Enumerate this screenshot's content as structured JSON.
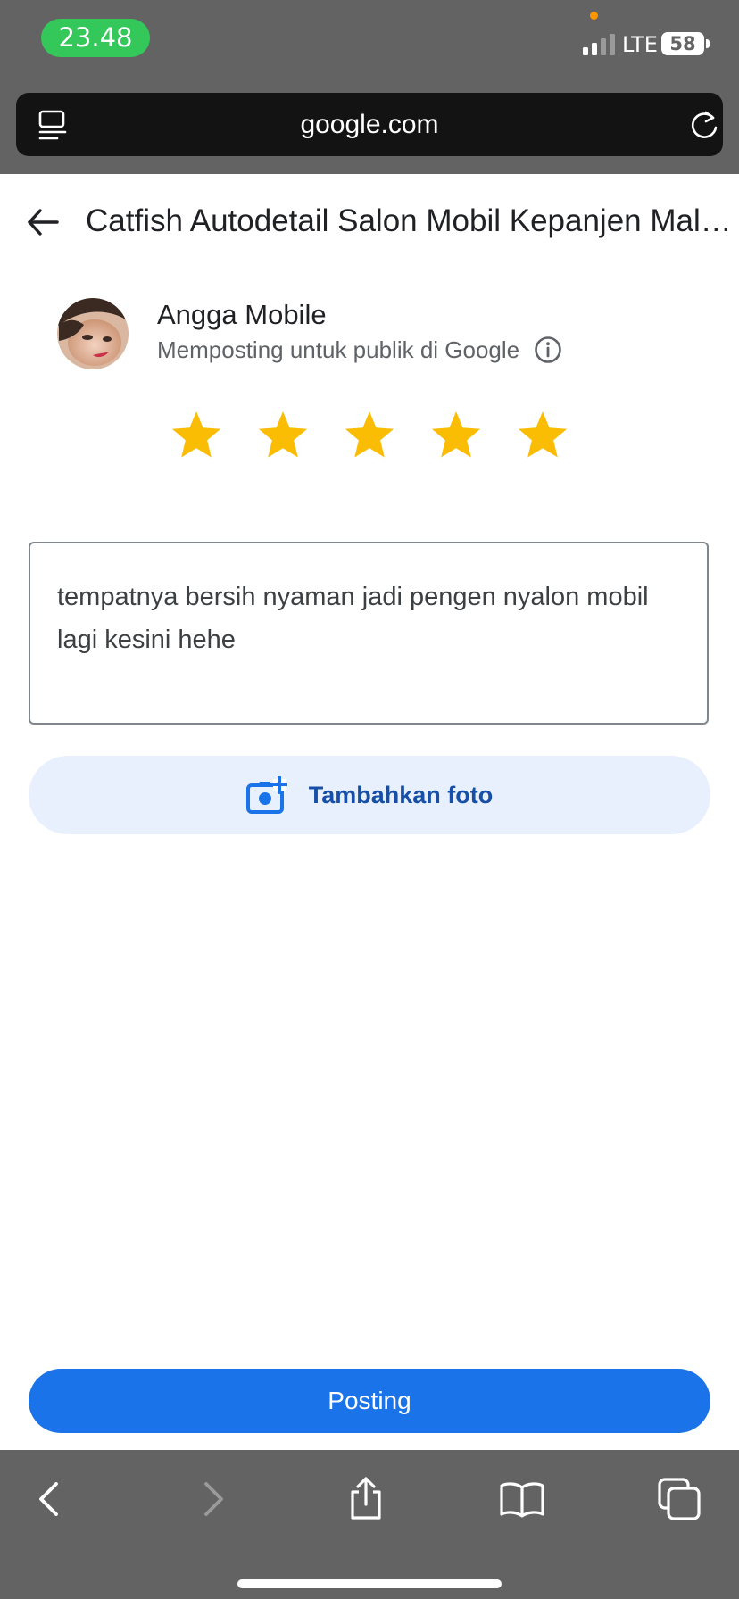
{
  "status_bar": {
    "time": "23.48",
    "network": "LTE",
    "battery": "58"
  },
  "browser": {
    "url": "google.com",
    "icons": {
      "reader": "reader-mode-icon",
      "reload": "reload-icon"
    }
  },
  "header": {
    "title": "Catfish Autodetail Salon Mobil Kepanjen Malang"
  },
  "user": {
    "name": "Angga Mobile",
    "posting_note": "Memposting untuk publik di Google"
  },
  "rating": {
    "value": 5,
    "max": 5,
    "color": "#fbbc04"
  },
  "review": {
    "text": "tempatnya bersih nyaman jadi pengen nyalon mobil lagi kesini hehe"
  },
  "add_photo": {
    "label": "Tambahkan foto"
  },
  "submit": {
    "label": "Posting"
  },
  "colors": {
    "accent": "#1a73e8",
    "chrome": "#636363",
    "time_pill": "#34c759"
  },
  "toolbar": {
    "items": [
      "back-icon",
      "forward-icon",
      "share-icon",
      "bookmarks-icon",
      "tabs-icon"
    ]
  }
}
